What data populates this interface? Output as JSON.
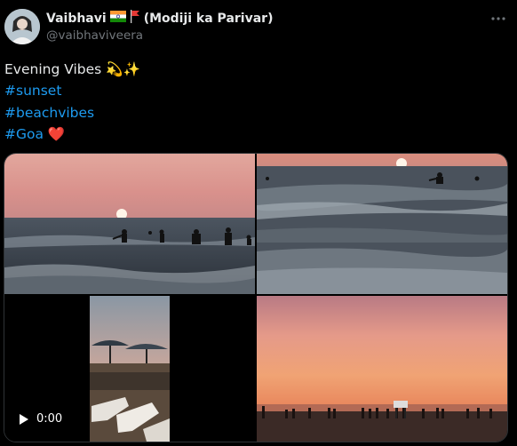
{
  "author": {
    "display_name": "Vaibhavi",
    "suffix": "(Modiji ka Parivar)",
    "handle": "@vaibhaviveera"
  },
  "post": {
    "line1": "Evening Vibes 💫✨",
    "hashtags": [
      "#sunset",
      "#beachvibes",
      "#Goa"
    ],
    "heart": "❤️"
  },
  "media": {
    "video_time": "0:00"
  },
  "icons": {
    "more": "more-icon",
    "play": "play-icon",
    "flag_india": "flag-india-icon",
    "flag_party": "flag-icon"
  },
  "colors": {
    "background": "#000000",
    "text": "#e7e9ea",
    "secondary": "#71767b",
    "link": "#1d9bf0"
  }
}
